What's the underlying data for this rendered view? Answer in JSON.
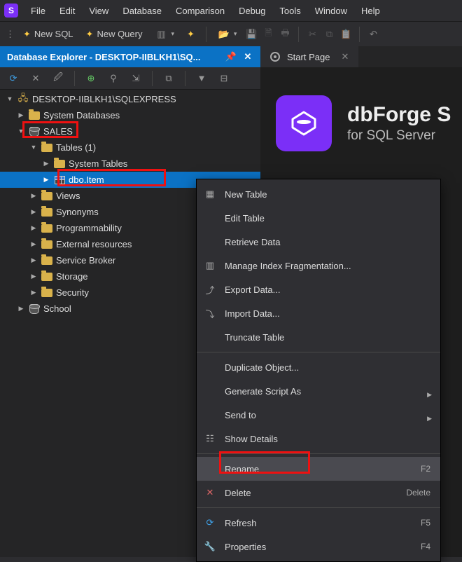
{
  "menubar": [
    "File",
    "Edit",
    "View",
    "Database",
    "Comparison",
    "Debug",
    "Tools",
    "Window",
    "Help"
  ],
  "toolbar": {
    "new_sql": "New SQL",
    "new_query": "New Query"
  },
  "panel": {
    "db_explorer_title": "Database Explorer - DESKTOP-IIBLKH1\\SQ...",
    "start_page": "Start Page"
  },
  "tree": {
    "server": "DESKTOP-IIBLKH1\\SQLEXPRESS",
    "system_databases": "System Databases",
    "sales": "SALES",
    "tables": "Tables (1)",
    "system_tables": "System Tables",
    "dbo_item": "dbo.Item",
    "views": "Views",
    "synonyms": "Synonyms",
    "programmability": "Programmability",
    "external_resources": "External resources",
    "service_broker": "Service Broker",
    "storage": "Storage",
    "security": "Security",
    "school": "School"
  },
  "brand": {
    "title": "dbForge S",
    "subtitle": "for SQL Server"
  },
  "context_menu": {
    "new_table": "New Table",
    "edit_table": "Edit Table",
    "retrieve_data": "Retrieve Data",
    "manage_index": "Manage Index Fragmentation...",
    "export_data": "Export Data...",
    "import_data": "Import Data...",
    "truncate_table": "Truncate Table",
    "duplicate_object": "Duplicate Object...",
    "generate_script": "Generate Script As",
    "send_to": "Send to",
    "show_details": "Show Details",
    "rename": "Rename",
    "rename_shortcut": "F2",
    "delete": "Delete",
    "delete_shortcut": "Delete",
    "refresh": "Refresh",
    "refresh_shortcut": "F5",
    "properties": "Properties",
    "properties_shortcut": "F4"
  }
}
